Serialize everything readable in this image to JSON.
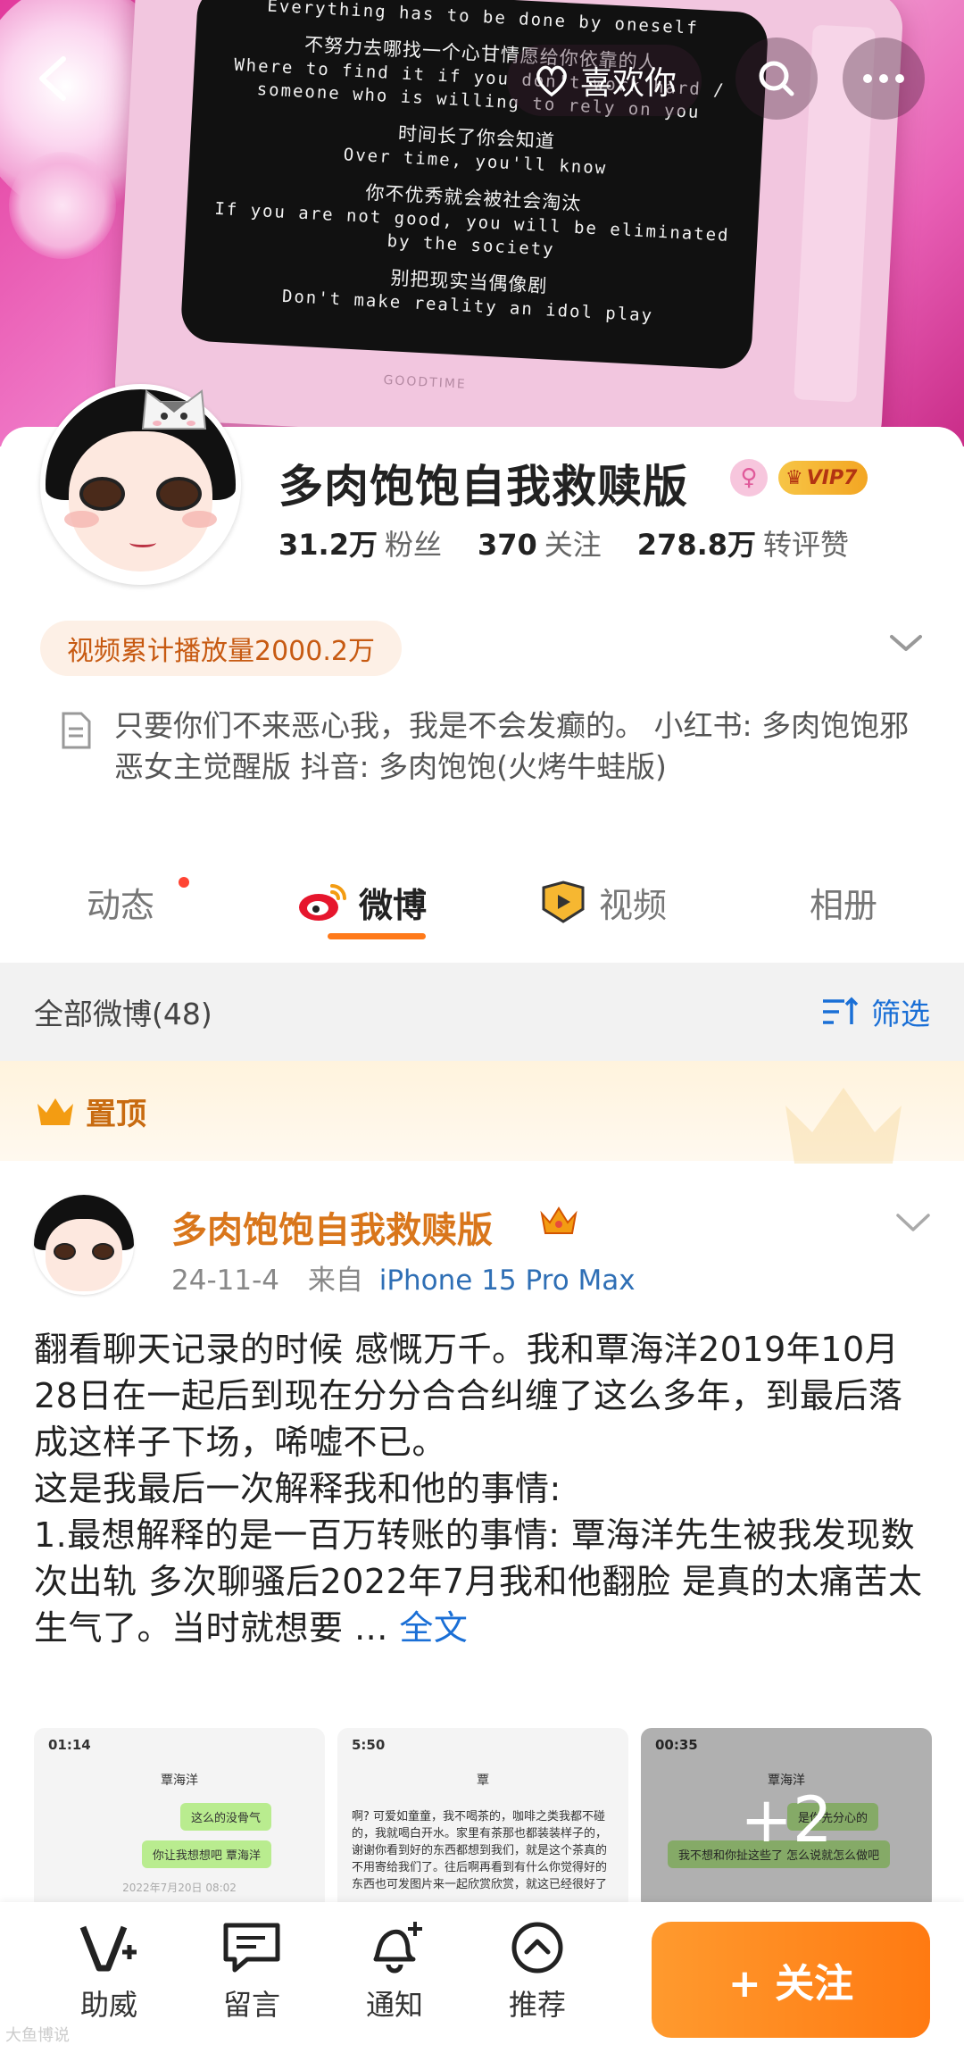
{
  "header": {
    "like_label": "喜欢你",
    "tv_lines": [
      {
        "zh": "",
        "en": "Everything has to be done by oneself"
      },
      {
        "zh": "不努力去哪找一个心甘情愿给你依靠的人",
        "en": "Where to find it if you don't work hard / someone who is willing to rely on you"
      },
      {
        "zh": "时间长了你会知道",
        "en": "Over time, you'll know"
      },
      {
        "zh": "你不优秀就会被社会淘汰",
        "en": "If you are not good, you will be eliminated by the society"
      },
      {
        "zh": "别把现实当偶像剧",
        "en": "Don't make reality an idol play"
      }
    ],
    "tv_brand": "GOODTIME"
  },
  "profile": {
    "name": "多肉饱饱自我救赎版",
    "vip_label": "VIP7",
    "stats": [
      {
        "num": "31.2万",
        "label": "粉丝"
      },
      {
        "num": "370",
        "label": "关注"
      },
      {
        "num": "278.8万",
        "label": "转评赞"
      }
    ],
    "plays": "视频累计播放量2000.2万",
    "bio": "只要你们不来恶心我，我是不会发癫的。 小红书: 多肉饱饱邪恶女主觉醒版 抖音: 多肉饱饱(火烤牛蛙版)"
  },
  "tabs": [
    {
      "label": "动态"
    },
    {
      "label": "微博"
    },
    {
      "label": "视频"
    },
    {
      "label": "相册"
    }
  ],
  "filter": {
    "count_label": "全部微博(48)",
    "filter_label": "筛选"
  },
  "pinned": {
    "label": "置顶"
  },
  "post": {
    "author": "多肉饱饱自我救赎版",
    "date": "24-11-4",
    "from_label": "来自",
    "device": "iPhone 15 Pro Max",
    "text": "翻看聊天记录的时候 感慨万千。我和覃海洋2019年10月28日在一起后到现在分分合合纠缠了这么多年，到最后落成这样子下场，唏嘘不已。\n这是我最后一次解释我和他的事情:\n1.最想解释的是一百万转账的事情: 覃海洋先生被我发现数次出轨 多次聊骚后2022年7月我和他翻脸 是真的太痛苦太生气了。当时就想要 ...",
    "more_label": "全文",
    "thumbs": [
      {
        "time": "01:14",
        "contact": "覃海洋",
        "bubbles": [
          "这么的没骨气",
          "你让我想想吧 覃海洋"
        ],
        "date": "2022年7月20日 08:02"
      },
      {
        "time": "5:50",
        "contact": "覃",
        "para": "啊? 可爱如童童，我不喝茶的，咖啡之类我都不碰的，我就喝白开水。家里有茶那也都装装样子的，谢谢你看到好的东西都想到我们，就是这个茶真的不用寄给我们了。往后啊再看到有什么你觉得好的东西也可发图片来一起欣赏欣赏，就这已经很好了"
      },
      {
        "time": "00:35",
        "contact": "覃海洋",
        "bubbles": [
          "是你先分心的",
          "我不想和你扯这些了 怎么说就怎么做吧"
        ],
        "more": "+2"
      }
    ]
  },
  "bottom_bar": {
    "items": [
      {
        "label": "助威"
      },
      {
        "label": "留言"
      },
      {
        "label": "通知"
      },
      {
        "label": "推荐"
      }
    ],
    "follow_label": "+ 关注"
  },
  "watermark": "大鱼博说",
  "colors": {
    "accent": "#ff7a1a",
    "link": "#1a6fd6",
    "name_orange": "#d9761b"
  }
}
